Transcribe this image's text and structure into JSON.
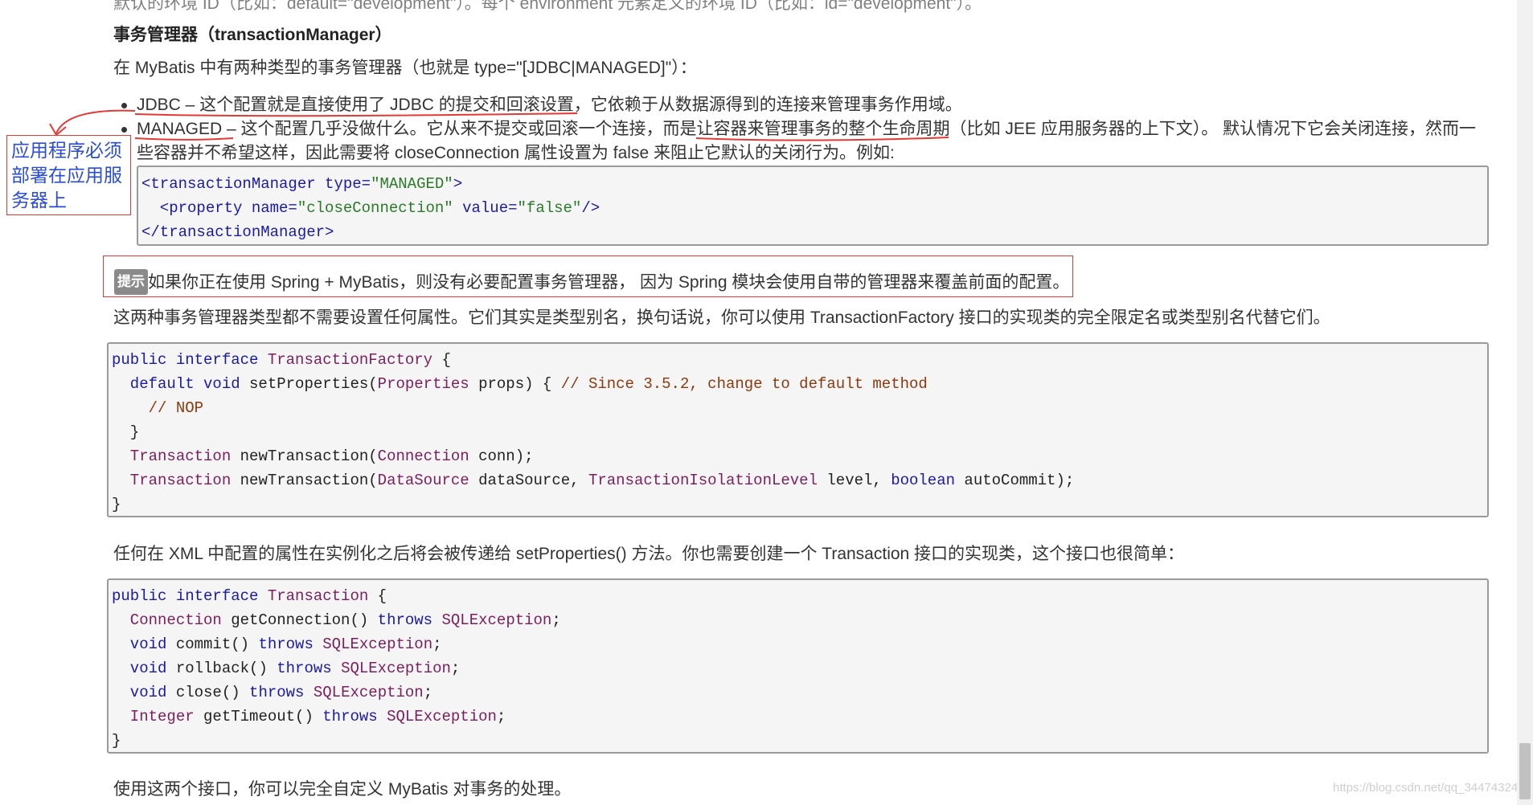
{
  "top_fragment": "默认的环境 ID（比如：default=\"development\"）。每个 environment 元素定义的环境 ID（比如：id=\"development\"）。",
  "section_heading": "事务管理器（transactionManager）",
  "intro": "在 MyBatis 中有两种类型的事务管理器（也就是 type=\"[JDBC|MANAGED]\"）：",
  "bullets": [
    {
      "label": "JDBC",
      "text": " – 这个配置就是直接使用了 JDBC 的提交和回滚设置，它依赖于从数据源得到的连接来管理事务作用域。"
    },
    {
      "label": "MANAGED",
      "text": " – 这个配置几乎没做什么。它从来不提交或回滚一个连接，而是让容器来管理事务的整个生命周期（比如 JEE 应用服务器的上下文）。 默认情况下它会关闭连接，然而一",
      "cont": "些容器并不希望这样，因此需要将 closeConnection 属性设置为 false 来阻止它默认的关闭行为。例如:"
    }
  ],
  "xml_example": {
    "lines": [
      {
        "parts": [
          {
            "t": "<transactionManager ",
            "c": "tag"
          },
          {
            "t": "type=",
            "c": "tag"
          },
          {
            "t": "\"MANAGED\"",
            "c": "st"
          },
          {
            "t": ">",
            "c": "tag"
          }
        ]
      },
      {
        "parts": [
          {
            "t": "  <property ",
            "c": "tag"
          },
          {
            "t": "name=",
            "c": "tag"
          },
          {
            "t": "\"closeConnection\"",
            "c": "st"
          },
          {
            "t": " value=",
            "c": "tag"
          },
          {
            "t": "\"false\"",
            "c": "st"
          },
          {
            "t": "/>",
            "c": "tag"
          }
        ]
      },
      {
        "parts": [
          {
            "t": "</transactionManager>",
            "c": "tag"
          }
        ]
      }
    ]
  },
  "annotation": {
    "lines": [
      "应用程序必须",
      "部署在应用服",
      "务器上"
    ]
  },
  "tip": {
    "badge": "提示",
    "text": "如果你正在使用 Spring + MyBatis，则没有必要配置事务管理器， 因为 Spring 模块会使用自带的管理器来覆盖前面的配置。"
  },
  "para_factory": "这两种事务管理器类型都不需要设置任何属性。它们其实是类型别名，换句话说，你可以使用 TransactionFactory 接口的实现类的完全限定名或类型别名代替它们。",
  "factory_code": {
    "lines": [
      {
        "parts": [
          {
            "t": "public interface ",
            "c": "kw"
          },
          {
            "t": "TransactionFactory",
            "c": "ty"
          },
          {
            "t": " {",
            "c": ""
          }
        ]
      },
      {
        "parts": [
          {
            "t": "  default void ",
            "c": "kw"
          },
          {
            "t": "setProperties(",
            "c": ""
          },
          {
            "t": "Properties",
            "c": "ty"
          },
          {
            "t": " props) { ",
            "c": ""
          },
          {
            "t": "// Since 3.5.2, change to default method",
            "c": "cm"
          }
        ]
      },
      {
        "parts": [
          {
            "t": "    // NOP",
            "c": "cm"
          }
        ]
      },
      {
        "parts": [
          {
            "t": "  }",
            "c": ""
          }
        ]
      },
      {
        "parts": [
          {
            "t": "  Transaction",
            "c": "ty"
          },
          {
            "t": " newTransaction(",
            "c": ""
          },
          {
            "t": "Connection",
            "c": "ty"
          },
          {
            "t": " conn);",
            "c": ""
          }
        ]
      },
      {
        "parts": [
          {
            "t": "  Transaction",
            "c": "ty"
          },
          {
            "t": " newTransaction(",
            "c": ""
          },
          {
            "t": "DataSource",
            "c": "ty"
          },
          {
            "t": " dataSource, ",
            "c": ""
          },
          {
            "t": "TransactionIsolationLevel",
            "c": "ty"
          },
          {
            "t": " level, ",
            "c": ""
          },
          {
            "t": "boolean",
            "c": "kw"
          },
          {
            "t": " autoCommit);",
            "c": ""
          }
        ]
      },
      {
        "parts": [
          {
            "t": "}",
            "c": ""
          }
        ]
      }
    ]
  },
  "para_transaction": "任何在 XML 中配置的属性在实例化之后将会被传递给 setProperties() 方法。你也需要创建一个 Transaction 接口的实现类，这个接口也很简单：",
  "transaction_code": {
    "lines": [
      {
        "parts": [
          {
            "t": "public interface ",
            "c": "kw"
          },
          {
            "t": "Transaction",
            "c": "ty"
          },
          {
            "t": " {",
            "c": ""
          }
        ]
      },
      {
        "parts": [
          {
            "t": "  Connection",
            "c": "ty"
          },
          {
            "t": " getConnection() ",
            "c": ""
          },
          {
            "t": "throws ",
            "c": "kw"
          },
          {
            "t": "SQLException",
            "c": "ty"
          },
          {
            "t": ";",
            "c": ""
          }
        ]
      },
      {
        "parts": [
          {
            "t": "  void ",
            "c": "kw"
          },
          {
            "t": "commit() ",
            "c": ""
          },
          {
            "t": "throws ",
            "c": "kw"
          },
          {
            "t": "SQLException",
            "c": "ty"
          },
          {
            "t": ";",
            "c": ""
          }
        ]
      },
      {
        "parts": [
          {
            "t": "  void ",
            "c": "kw"
          },
          {
            "t": "rollback() ",
            "c": ""
          },
          {
            "t": "throws ",
            "c": "kw"
          },
          {
            "t": "SQLException",
            "c": "ty"
          },
          {
            "t": ";",
            "c": ""
          }
        ]
      },
      {
        "parts": [
          {
            "t": "  void ",
            "c": "kw"
          },
          {
            "t": "close() ",
            "c": ""
          },
          {
            "t": "throws ",
            "c": "kw"
          },
          {
            "t": "SQLException",
            "c": "ty"
          },
          {
            "t": ";",
            "c": ""
          }
        ]
      },
      {
        "parts": [
          {
            "t": "  Integer",
            "c": "ty"
          },
          {
            "t": " getTimeout() ",
            "c": ""
          },
          {
            "t": "throws ",
            "c": "kw"
          },
          {
            "t": "SQLException",
            "c": "ty"
          },
          {
            "t": ";",
            "c": ""
          }
        ]
      },
      {
        "parts": [
          {
            "t": "}",
            "c": ""
          }
        ]
      }
    ]
  },
  "para_final": "使用这两个接口，你可以完全自定义 MyBatis 对事务的处理。",
  "watermark": "https://blog.csdn.net/qq_34474324",
  "colors": {
    "annotation_red": "#e53935",
    "annotation_blue": "#2a4cd7",
    "code_bg": "#f5f5f5"
  }
}
